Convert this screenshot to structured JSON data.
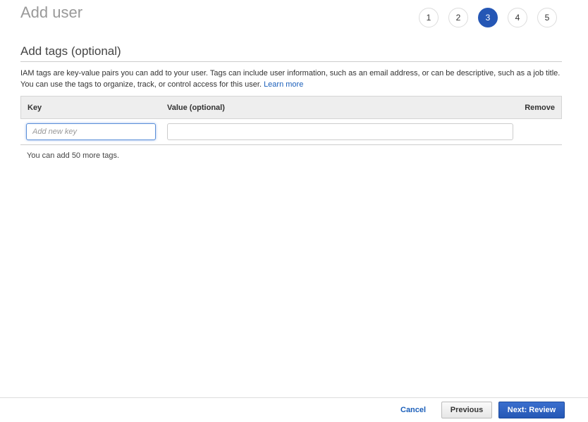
{
  "page": {
    "title": "Add user"
  },
  "steps": [
    {
      "label": "1",
      "active": false
    },
    {
      "label": "2",
      "active": false
    },
    {
      "label": "3",
      "active": true
    },
    {
      "label": "4",
      "active": false
    },
    {
      "label": "5",
      "active": false
    }
  ],
  "section": {
    "title": "Add tags (optional)",
    "description": "IAM tags are key-value pairs you can add to your user. Tags can include user information, such as an email address, or can be descriptive, such as a job title. You can use the tags to organize, track, or control access for this user.",
    "learn_more": "Learn more"
  },
  "table": {
    "headers": {
      "key": "Key",
      "value": "Value (optional)",
      "remove": "Remove"
    },
    "row": {
      "key_placeholder": "Add new key",
      "key_value": "",
      "value_value": ""
    }
  },
  "tags_remaining_text": "You can add 50 more tags.",
  "footer": {
    "cancel": "Cancel",
    "previous": "Previous",
    "next": "Next: Review"
  },
  "colors": {
    "accent": "#2557b5",
    "link": "#1b5fba"
  }
}
